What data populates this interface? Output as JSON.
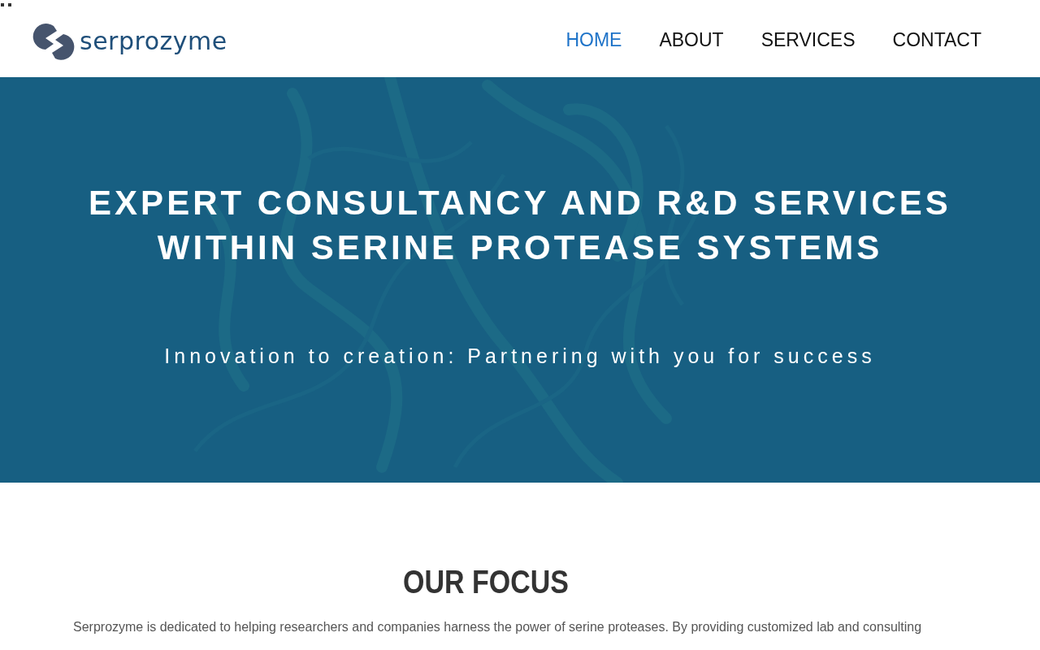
{
  "header": {
    "logo_text": "serprozyme",
    "nav": [
      {
        "label": "HOME",
        "selected": true
      },
      {
        "label": "ABOUT",
        "selected": false
      },
      {
        "label": "SERVICES",
        "selected": false
      },
      {
        "label": "CONTACT",
        "selected": false
      }
    ]
  },
  "hero": {
    "kind": "picture",
    "title_lines": [
      "EXPERT CONSULTANCY AND R&D SERVICES",
      "WITHIN SERINE PROTEASE SYSTEMS"
    ],
    "subtitle": "Innovation to creation: Partnering with you for success"
  },
  "focus": {
    "heading": "OUR FOCUS",
    "paragraph": "Serprozyme is dedicated to helping researchers and companies harness the power of serine proteases. By providing customized lab and consulting"
  }
}
